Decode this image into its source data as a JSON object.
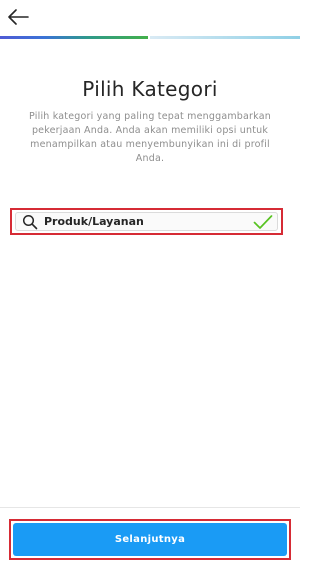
{
  "header": {
    "back_icon": "arrow-left-icon"
  },
  "progress": {
    "step": 1,
    "total_steps": 2
  },
  "content": {
    "title": "Pilih Kategori",
    "description": "Pilih kategori yang paling tepat menggambarkan pekerjaan Anda. Anda akan memiliki opsi untuk menampilkan atau menyembunyikan ini di profil Anda."
  },
  "search": {
    "value": "Produk/Layanan",
    "icon": "search-icon",
    "status_icon": "check-icon"
  },
  "footer": {
    "next_label": "Selanjutnya"
  },
  "colors": {
    "accent": "#1a9bf5",
    "highlight": "#d62b35",
    "check": "#58c322",
    "text": "#262626",
    "muted": "#8e8e8e"
  }
}
